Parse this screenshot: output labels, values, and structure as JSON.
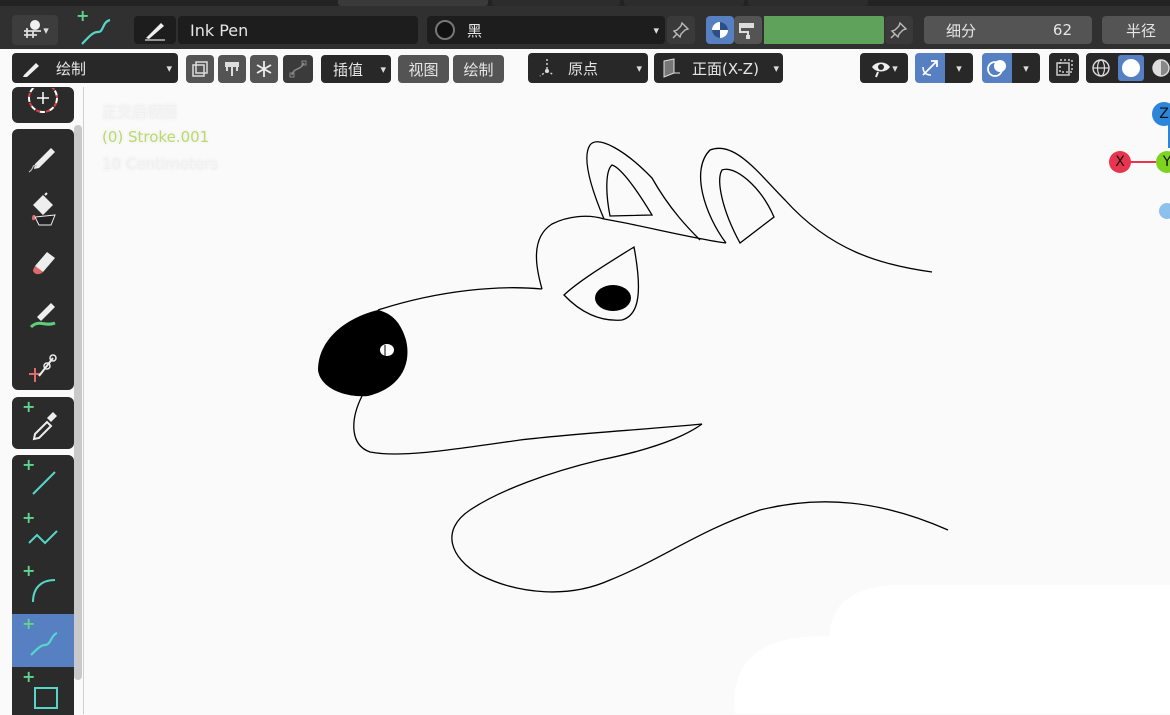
{
  "header": {
    "brush_name": "Ink Pen",
    "material_name": "黑",
    "subdivision_label": "细分",
    "subdivision_value": "62",
    "radius_label": "半径",
    "accent_color": "#5680c2",
    "color_swatch": "#5fa25b"
  },
  "toolbar": {
    "mode_label": "绘制",
    "interpolate_label": "插值",
    "view_label": "视图",
    "draw_label": "绘制",
    "origin_label": "原点",
    "plane_label": "正面(X-Z)"
  },
  "viewport": {
    "view_name": "正交后视图",
    "object_name": "(0) Stroke.001",
    "scale_text": "10 Centimeters"
  },
  "gizmo": {
    "z": "Z",
    "x": "X",
    "y": "Y"
  }
}
